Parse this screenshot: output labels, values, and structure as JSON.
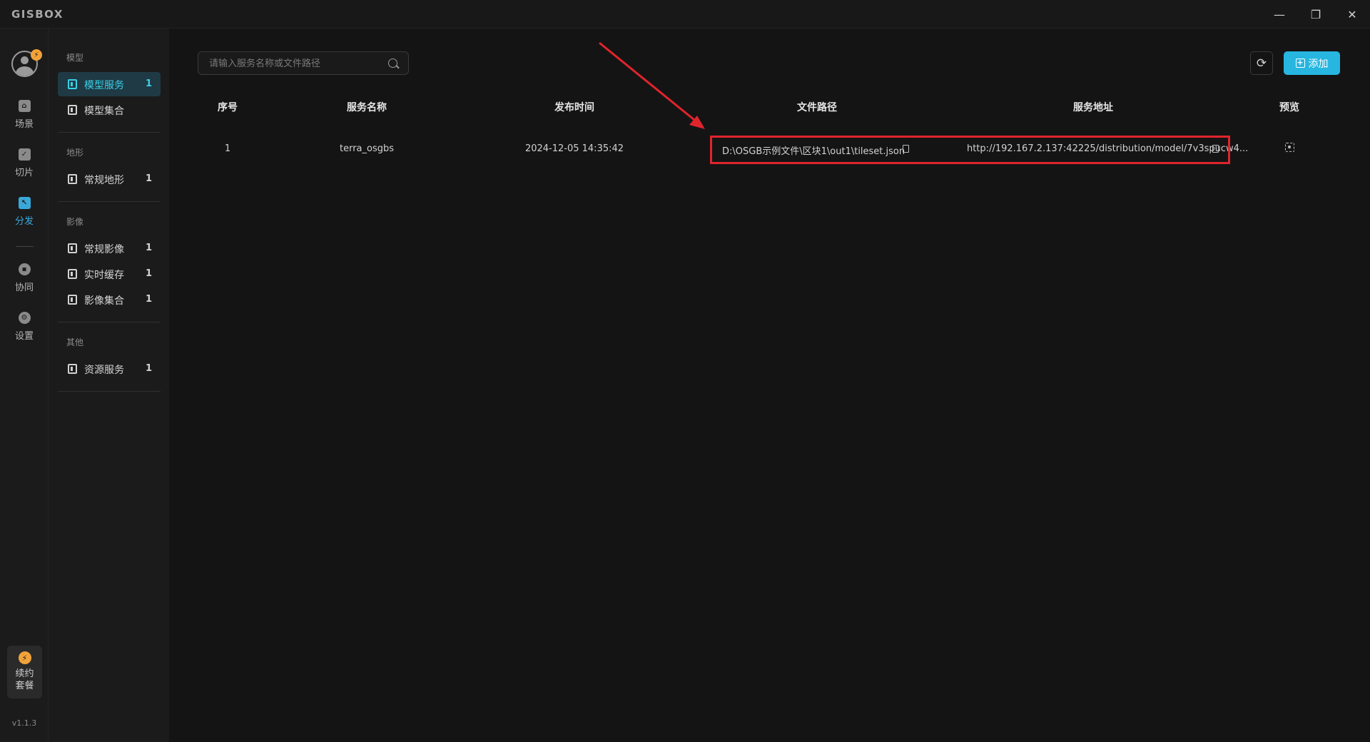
{
  "app": {
    "logo": "GISBOX",
    "version": "v1.1.3"
  },
  "window_controls": {
    "minimize": "—",
    "restore": "❐",
    "close": "✕"
  },
  "avatar": {
    "badge_icon": "lightning-icon"
  },
  "rail": {
    "items": [
      {
        "label": "场景",
        "icon": "home-icon"
      },
      {
        "label": "切片",
        "icon": "slice-icon"
      },
      {
        "label": "分发",
        "icon": "distribute-icon",
        "active": true
      },
      {
        "label": "协同",
        "icon": "lock-icon"
      },
      {
        "label": "设置",
        "icon": "gear-icon"
      }
    ],
    "renew": {
      "line1": "续约",
      "line2": "套餐"
    }
  },
  "subnav": {
    "sections": [
      {
        "title": "模型",
        "items": [
          {
            "label": "模型服务",
            "count": "1",
            "active": true
          },
          {
            "label": "模型集合",
            "count": ""
          }
        ]
      },
      {
        "title": "地形",
        "items": [
          {
            "label": "常规地形",
            "count": "1"
          }
        ]
      },
      {
        "title": "影像",
        "items": [
          {
            "label": "常规影像",
            "count": "1"
          },
          {
            "label": "实时缓存",
            "count": "1"
          },
          {
            "label": "影像集合",
            "count": "1"
          }
        ]
      },
      {
        "title": "其他",
        "items": [
          {
            "label": "资源服务",
            "count": "1"
          }
        ]
      }
    ]
  },
  "search": {
    "placeholder": "请输入服务名称或文件路径",
    "value": ""
  },
  "toolbar": {
    "add_label": "添加"
  },
  "table": {
    "headers": [
      "序号",
      "服务名称",
      "发布时间",
      "文件路径",
      "服务地址",
      "预览"
    ],
    "rows": [
      {
        "index": "1",
        "name": "terra_osgbs",
        "time": "2024-12-05 14:35:42",
        "path": "D:\\OSGB示例文件\\区块1\\out1\\tileset.json",
        "url": "http://192.167.2.137:42225/distribution/model/7v3spucw4..."
      }
    ]
  },
  "colors": {
    "accent": "#26b6e0",
    "highlight": "#e0242c",
    "background": "#141414"
  }
}
